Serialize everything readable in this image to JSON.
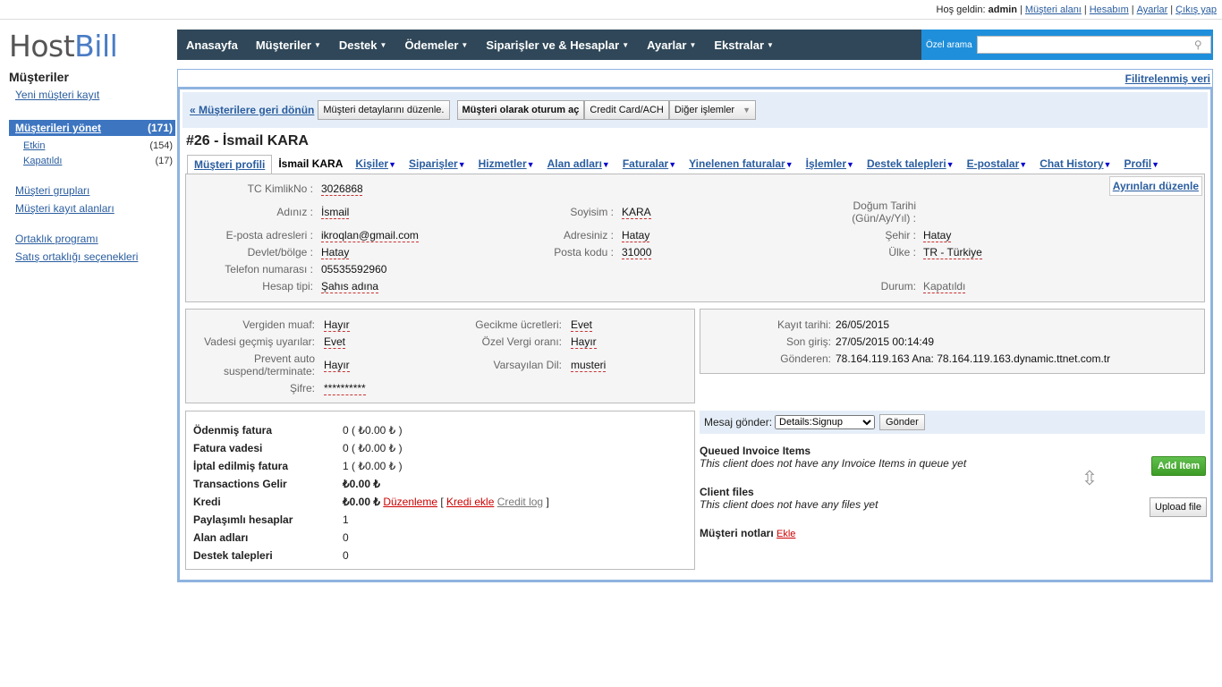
{
  "topbar": {
    "welcome": "Hoş geldin:",
    "user": "admin",
    "links": [
      "Müşteri alanı",
      "Hesabım",
      "Ayarlar",
      "Çıkış yap"
    ]
  },
  "logo": {
    "part1": "Host",
    "part2": "Bill"
  },
  "nav": {
    "items": [
      "Anasayfa",
      "Müşteriler",
      "Destek",
      "Ödemeler",
      "Siparişler ve & Hesaplar",
      "Ayarlar",
      "Ekstralar"
    ],
    "search_label": "Özel arama"
  },
  "sidebar": {
    "title": "Müşteriler",
    "new_client": "Yeni müşteri kayıt",
    "manage": "Müşterileri yönet",
    "manage_count": "(171)",
    "active": "Etkin",
    "active_count": "(154)",
    "closed": "Kapatıldı",
    "closed_count": "(17)",
    "groups": "Müşteri grupları",
    "fields": "Müşteri kayıt alanları",
    "affiliate": "Ortaklık programı",
    "affiliate_opts": "Satış ortaklığı seçenekleri"
  },
  "filter_link": "Filitrelenmiş veri",
  "actions": {
    "back": "« Müşterilere geri dönün",
    "edit": "Müşteri detaylarını düzenle.",
    "login_as": "Müşteri olarak oturum aç",
    "credit_card": "Credit Card/ACH",
    "other": "Diğer işlemler"
  },
  "client_title": "#26 - İsmail KARA",
  "tabs": [
    "Müşteri profili",
    "İsmail KARA",
    "Kişiler",
    "Siparişler",
    "Hizmetler",
    "Alan adları",
    "Faturalar",
    "Yinelenen faturalar",
    "İşlemler",
    "Destek talepleri",
    "E-postalar",
    "Chat History",
    "Profil"
  ],
  "profile": {
    "edit_details": "Ayrınları düzenle",
    "tc_label": "TC KimlikNo :",
    "tc_value": "3026868",
    "name_label": "Adınız :",
    "name_value": "İsmail",
    "surname_label": "Soyisim :",
    "surname_value": "KARA",
    "birth_label": "Doğum Tarihi (Gün/Ay/Yıl) :",
    "email_label": "E-posta adresleri :",
    "email_value": "ikroqlan@gmail.com",
    "address_label": "Adresiniz :",
    "address_value": "Hatay",
    "city_label": "Şehir :",
    "city_value": "Hatay",
    "state_label": "Devlet/bölge :",
    "state_value": "Hatay",
    "postcode_label": "Posta kodu :",
    "postcode_value": "31000",
    "country_label": "Ülke :",
    "country_value": "TR - Türkiye",
    "phone_label": "Telefon numarası :",
    "phone_value": "05535592960",
    "acct_label": "Hesap tipi:",
    "acct_value": "Şahıs adına",
    "status_label": "Durum:",
    "status_value": "Kapatıldı"
  },
  "settings": {
    "tax_label": "Vergiden muaf:",
    "tax_value": "Hayır",
    "late_label": "Gecikme ücretleri:",
    "late_value": "Evet",
    "overdue_label": "Vadesi geçmiş uyarılar:",
    "overdue_value": "Evet",
    "vat_label": "Özel Vergi oranı:",
    "vat_value": "Hayır",
    "prevent_label": "Prevent auto suspend/terminate:",
    "prevent_value": "Hayır",
    "lang_label": "Varsayılan Dil:",
    "lang_value": "musteri",
    "pw_label": "Şifre:",
    "pw_value": "**********"
  },
  "reg": {
    "date_label": "Kayıt tarihi:",
    "date_value": "26/05/2015",
    "last_label": "Son giriş:",
    "last_value": "27/05/2015 00:14:49",
    "from_label": "Gönderen:",
    "from_value": "78.164.119.163 Ana: 78.164.119.163.dynamic.ttnet.com.tr"
  },
  "stats": [
    {
      "label": "Ödenmiş fatura",
      "value": "0 ( ₺0.00 ₺ )"
    },
    {
      "label": "Fatura vadesi",
      "value": "0 ( ₺0.00 ₺ )"
    },
    {
      "label": "İptal edilmiş fatura",
      "value": "1 ( ₺0.00 ₺ )"
    },
    {
      "label": "Transactions Gelir",
      "value": "₺0.00 ₺"
    },
    {
      "label": "Kredi",
      "value": "₺0.00 ₺"
    },
    {
      "label": "Paylaşımlı hesaplar",
      "value": "1"
    },
    {
      "label": "Alan adları",
      "value": "0"
    },
    {
      "label": "Destek talepleri",
      "value": "0"
    }
  ],
  "credit_links": {
    "edit": "Düzenleme",
    "add": "Kredi ekle",
    "log": "Credit log"
  },
  "message": {
    "label": "Mesaj gönder:",
    "selected": "Details:Signup",
    "send": "Gönder"
  },
  "queued": {
    "title": "Queued Invoice Items",
    "text": "This client does not have any Invoice Items in queue yet",
    "button": "Add Item"
  },
  "files": {
    "title": "Client files",
    "text": "This client does not have any files yet",
    "button": "Upload file"
  },
  "notes": {
    "title": "Müşteri notları",
    "add": "Ekle"
  }
}
